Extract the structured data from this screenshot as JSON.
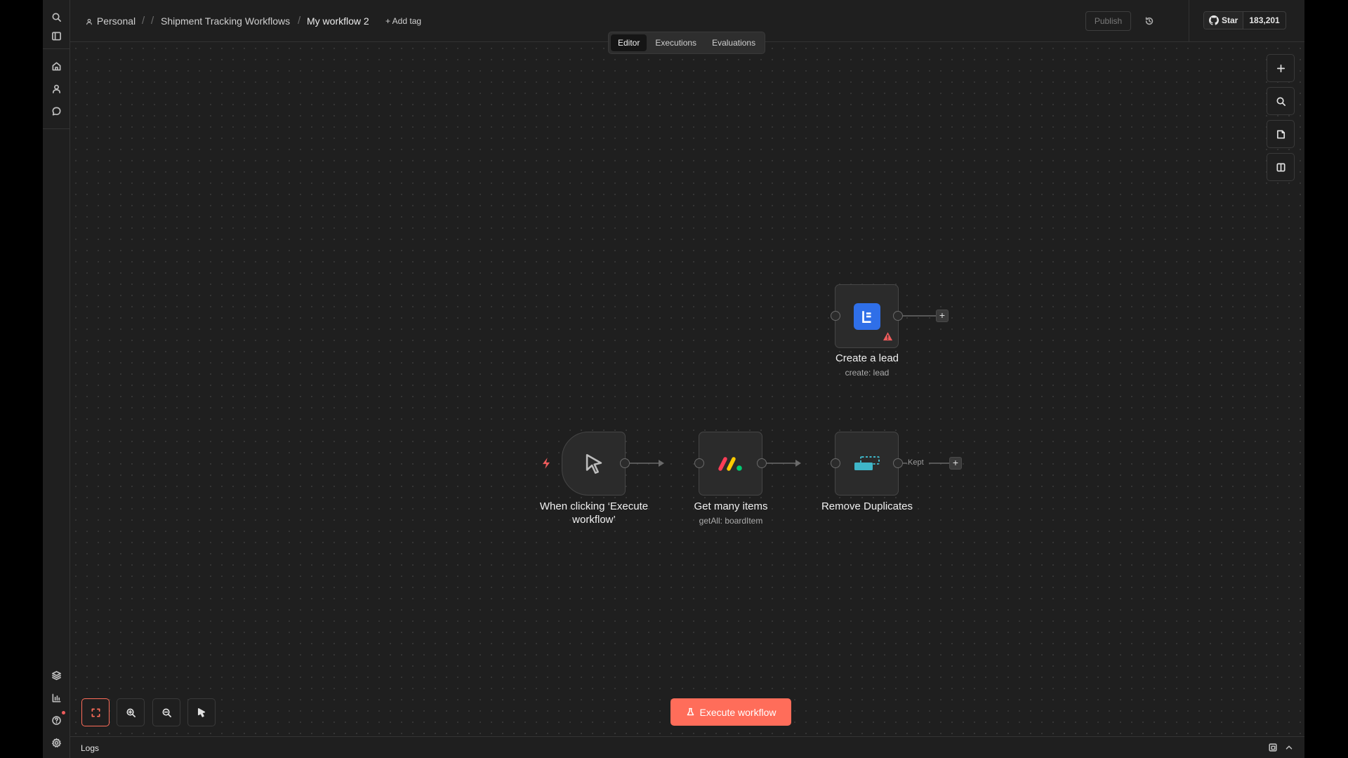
{
  "breadcrumb": {
    "owner": "Personal",
    "project": "Shipment Tracking Workflows",
    "workflow_name": "My workflow 2",
    "add_tag": "+ Add tag"
  },
  "header": {
    "publish_label": "Publish",
    "github_star_label": "Star",
    "github_star_count": "183,201"
  },
  "tabs": [
    {
      "label": "Editor",
      "active": true
    },
    {
      "label": "Executions",
      "active": false
    },
    {
      "label": "Evaluations",
      "active": false
    }
  ],
  "nodes": {
    "trigger": {
      "label": "When clicking ‘Execute workflow’",
      "icon": "cursor-icon"
    },
    "monday": {
      "label": "Get many items",
      "subtitle": "getAll: boardItem",
      "icon": "monday-logo"
    },
    "remove_duplicates": {
      "label": "Remove Duplicates",
      "icon": "remove-duplicates-icon",
      "output_label": "Kept"
    },
    "create_lead": {
      "label": "Create a lead",
      "subtitle": "create: lead",
      "icon": "lead-crm-icon",
      "has_warning": true
    }
  },
  "execute_button": {
    "label": "Execute workflow"
  },
  "logs": {
    "title": "Logs"
  },
  "colors": {
    "accent": "#ff6d5a",
    "background": "#1f1f1f",
    "node_bg": "#2b2b2b",
    "warning": "#ef5c5c",
    "create_lead_icon_bg": "#2f6fe8",
    "remove_duplicates_icon": "#3fb6c8"
  }
}
